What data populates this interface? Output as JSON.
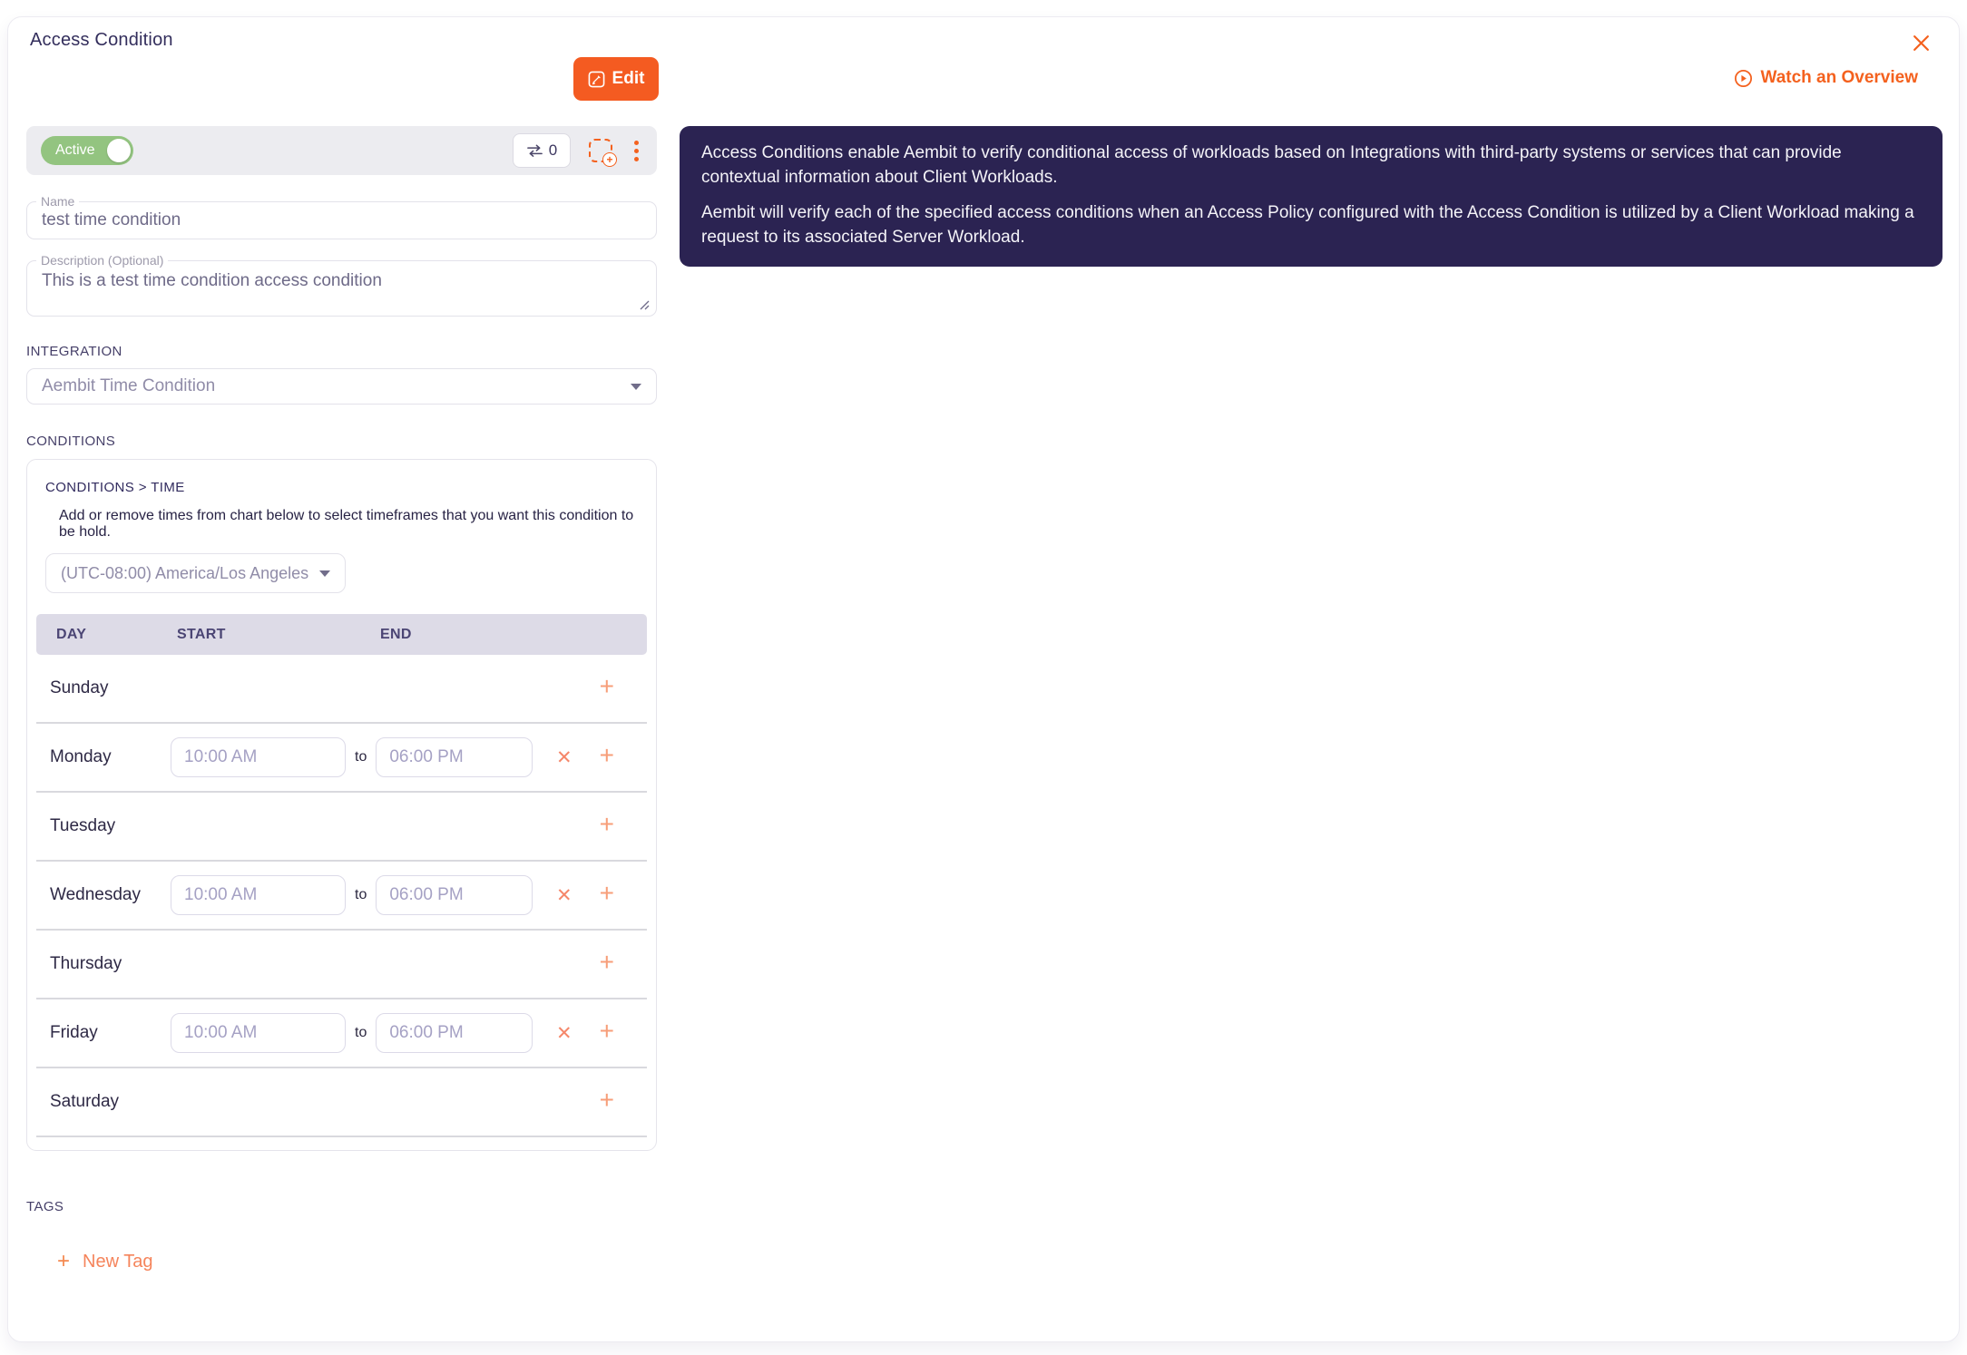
{
  "page": {
    "title": "Access Condition",
    "edit_label": "Edit",
    "watch_overview_label": "Watch an Overview"
  },
  "toolbar": {
    "status_label": "Active",
    "policy_count": "0"
  },
  "form": {
    "name": {
      "label": "Name",
      "value": "test time condition"
    },
    "description": {
      "label": "Description (Optional)",
      "value": "This is a test time condition access condition"
    },
    "integration": {
      "label": "INTEGRATION",
      "value": "Aembit Time Condition"
    },
    "conditions": {
      "label": "CONDITIONS",
      "breadcrumb": "CONDITIONS > TIME",
      "helper": "Add or remove times from chart below to select timeframes that you want this condition to be hold.",
      "timezone": "(UTC-08:00) America/Los Angeles",
      "table": {
        "headers": [
          "DAY",
          "START",
          "END"
        ],
        "to_label": "to",
        "rows": [
          {
            "day": "Sunday"
          },
          {
            "day": "Monday",
            "start": "10:00 AM",
            "end": "06:00 PM"
          },
          {
            "day": "Tuesday"
          },
          {
            "day": "Wednesday",
            "start": "10:00 AM",
            "end": "06:00 PM"
          },
          {
            "day": "Thursday"
          },
          {
            "day": "Friday",
            "start": "10:00 AM",
            "end": "06:00 PM"
          },
          {
            "day": "Saturday"
          }
        ]
      }
    },
    "tags": {
      "label": "TAGS",
      "new_tag_label": "New Tag"
    }
  },
  "info_panel": {
    "paragraph1": "Access Conditions enable Aembit to verify conditional access of workloads based on Integrations with third-party systems or services that can provide contextual information about Client Workloads.",
    "paragraph2": "Aembit will verify each of the specified access conditions when an Access Policy configured with the Access Condition is utilized by a Client Workload making a request to its associated Server Workload."
  },
  "colors": {
    "accent_orange": "#F4611E",
    "salmon": "#F79E79",
    "active_green": "#93C480",
    "info_panel_bg": "#2B2352",
    "table_header_bg": "#DDDBE7",
    "title_navy": "#332E5C"
  }
}
